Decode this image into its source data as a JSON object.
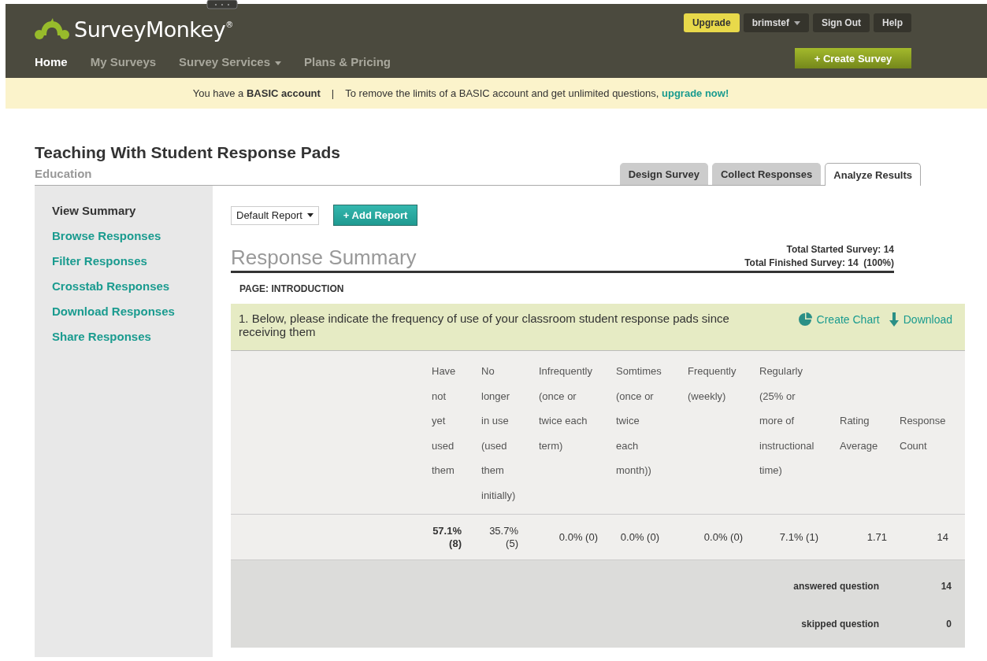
{
  "header": {
    "logo": "SurveyMonkey$^{®}$",
    "nav": [
      {
        "label": "Home",
        "selected": true,
        "dropdown": false
      },
      {
        "label": "My Surveys",
        "selected": false,
        "dropdown": false
      },
      {
        "label": "Survey Services",
        "selected": false,
        "dropdown": true
      },
      {
        "label": "Plans & Pricing",
        "selected": false,
        "dropdown": false
      }
    ],
    "account_buttons": [
      {
        "label": "Upgrade",
        "kind": "upgrade"
      },
      {
        "label": "brimstef",
        "kind": "menu"
      },
      {
        "label": "Sign Out",
        "kind": "plain"
      },
      {
        "label": "Help",
        "kind": "plain"
      }
    ],
    "create_button": "+ Create Survey"
  },
  "banner": {
    "account_text": "You have a **BASIC account**",
    "separator": "|",
    "message": "To remove the limits of a BASIC account and get unlimited questions,",
    "link": "upgrade now!"
  },
  "survey": {
    "title": "Teaching With Student Response Pads",
    "category": "Education"
  },
  "tabs": [
    {
      "label": "Design Survey",
      "selected": false
    },
    {
      "label": "Collect Responses",
      "selected": false
    },
    {
      "label": "Analyze Results",
      "selected": true
    }
  ],
  "sidebar": {
    "items": [
      {
        "label": "View Summary",
        "selected": true
      },
      {
        "label": "Browse Responses",
        "selected": false
      },
      {
        "label": "Filter Responses",
        "selected": false
      },
      {
        "label": "Crosstab Responses",
        "selected": false
      },
      {
        "label": "Download Responses",
        "selected": false
      },
      {
        "label": "Share Responses",
        "selected": false
      }
    ]
  },
  "report": {
    "report_select": "Default Report",
    "add_button": "+ Add Report",
    "heading": "Response Summary",
    "totals": [
      "Total Started Survey: 14",
      "Total Finished Survey: 14  (100%)"
    ],
    "page_label": "PAGE: INTRODUCTION",
    "question": {
      "text": "1. Below, please indicate the frequency of use of your classroom student response pads since receiving them",
      "actions": [
        {
          "label": "Create Chart",
          "kind": "chart"
        },
        {
          "label": "Download",
          "kind": "download"
        }
      ]
    },
    "table": {
      "columns": [
        {
          "label": "Have not yet used them",
          "kind": "choice"
        },
        {
          "label": "No longer in use (used them initially)",
          "kind": "choice"
        },
        {
          "label": "Infrequently (once or twice each term)",
          "kind": "choice"
        },
        {
          "label": "Somtimes (once or twice each month))",
          "kind": "choice"
        },
        {
          "label": "Frequently (weekly)",
          "kind": "choice"
        },
        {
          "label": "Regularly (25% or more of instructional time)",
          "kind": "choice"
        },
        {
          "label": "Rating Average",
          "kind": "stat"
        },
        {
          "label": "Response Count",
          "kind": "stat"
        }
      ],
      "rows": [
        {
          "cells": [
            {
              "text": "57.1% (8)",
              "highlight": true
            },
            {
              "text": "35.7% (5)",
              "highlight": false
            },
            {
              "text": "0.0% (0)",
              "highlight": false
            },
            {
              "text": "0.0% (0)",
              "highlight": false
            },
            {
              "text": "0.0% (0)",
              "highlight": false
            },
            {
              "text": "7.1% (1)",
              "highlight": false
            },
            {
              "text": "1.71",
              "highlight": false
            },
            {
              "text": "14",
              "highlight": false
            }
          ]
        }
      ],
      "summary": [
        {
          "label": "answered question",
          "value": "14"
        },
        {
          "label": "skipped question",
          "value": "0"
        }
      ]
    }
  }
}
